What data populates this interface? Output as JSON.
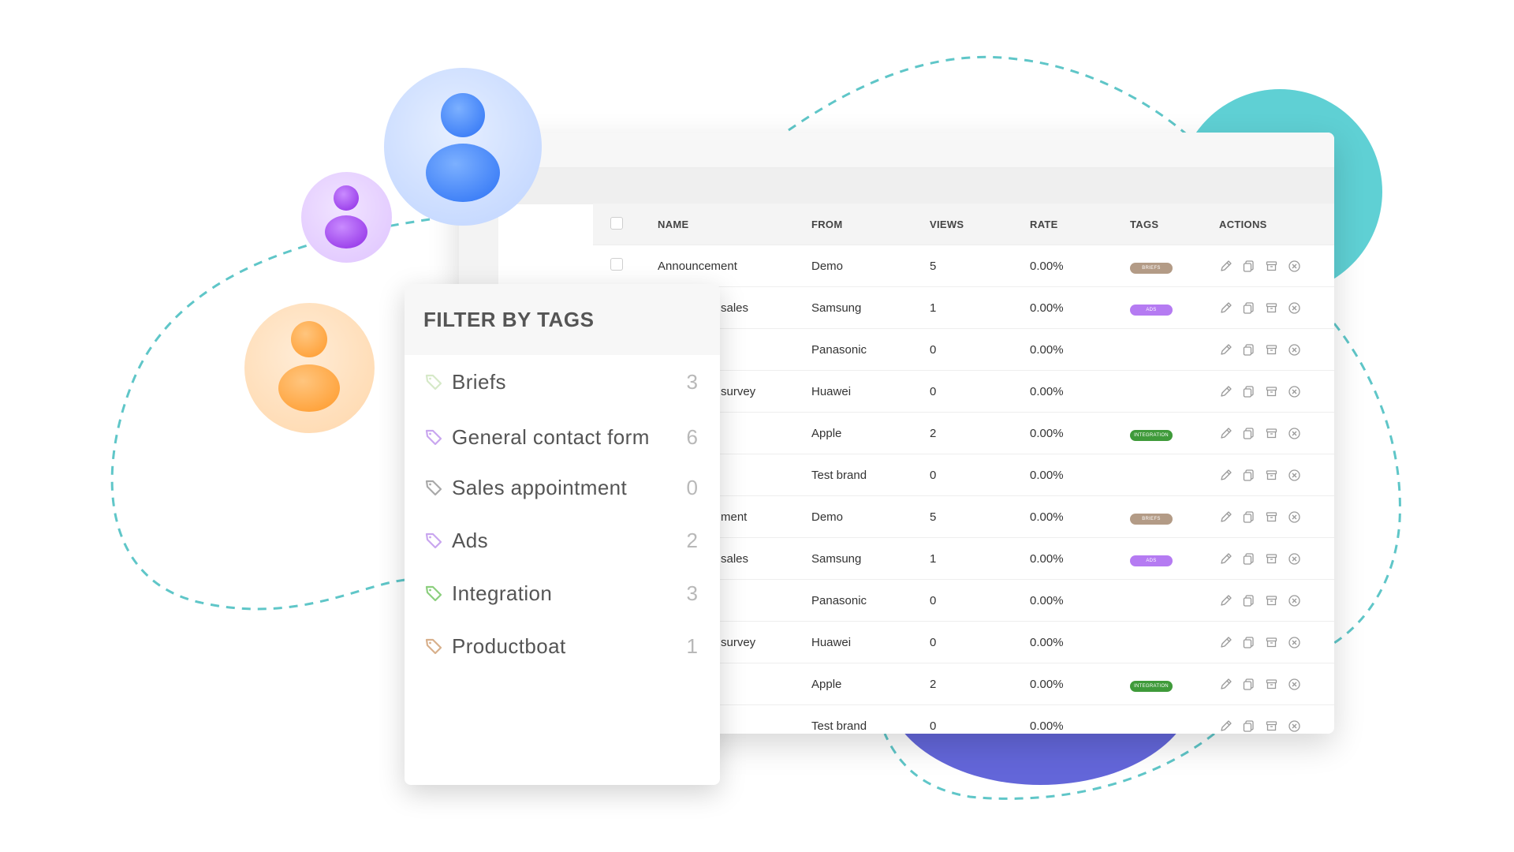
{
  "colors": {
    "teal": "#5fd0d4",
    "indigo": "#6366d9",
    "tag_briefs": "#b39b86",
    "tag_ads": "#b57bf2",
    "tag_integration": "#3f9a3a"
  },
  "table": {
    "columns": [
      "NAME",
      "FROM",
      "VIEWS",
      "RATE",
      "TAGS",
      "ACTIONS"
    ],
    "rows": [
      {
        "name": "Announcement",
        "from": "Demo",
        "views": "5",
        "rate": "0.00%",
        "tag": "BRIEFS",
        "tag_color": "#b39b86"
      },
      {
        "name": "sales",
        "from": "Samsung",
        "views": "1",
        "rate": "0.00%",
        "tag": "ADS",
        "tag_color": "#b57bf2"
      },
      {
        "name": "",
        "from": "Panasonic",
        "views": "0",
        "rate": "0.00%",
        "tag": "",
        "tag_color": ""
      },
      {
        "name": "survey",
        "from": "Huawei",
        "views": "0",
        "rate": "0.00%",
        "tag": "",
        "tag_color": ""
      },
      {
        "name": "",
        "from": "Apple",
        "views": "2",
        "rate": "0.00%",
        "tag": "INTEGRATION",
        "tag_color": "#3f9a3a"
      },
      {
        "name": "",
        "from": "Test brand",
        "views": "0",
        "rate": "0.00%",
        "tag": "",
        "tag_color": ""
      },
      {
        "name": "ment",
        "from": "Demo",
        "views": "5",
        "rate": "0.00%",
        "tag": "BRIEFS",
        "tag_color": "#b39b86"
      },
      {
        "name": "sales",
        "from": "Samsung",
        "views": "1",
        "rate": "0.00%",
        "tag": "ADS",
        "tag_color": "#b57bf2"
      },
      {
        "name": "",
        "from": "Panasonic",
        "views": "0",
        "rate": "0.00%",
        "tag": "",
        "tag_color": ""
      },
      {
        "name": "survey",
        "from": "Huawei",
        "views": "0",
        "rate": "0.00%",
        "tag": "",
        "tag_color": ""
      },
      {
        "name": "",
        "from": "Apple",
        "views": "2",
        "rate": "0.00%",
        "tag": "INTEGRATION",
        "tag_color": "#3f9a3a"
      },
      {
        "name": "",
        "from": "Test brand",
        "views": "0",
        "rate": "0.00%",
        "tag": "",
        "tag_color": ""
      }
    ],
    "action_icons": [
      "edit-icon",
      "duplicate-icon",
      "archive-icon",
      "delete-icon"
    ]
  },
  "filter": {
    "title": "FILTER BY TAGS",
    "items": [
      {
        "label": "Briefs",
        "count": "3",
        "color": "#d6e9c8"
      },
      {
        "label": "General contact form",
        "count": "6",
        "color": "#c9a6ef"
      },
      {
        "label": "Sales appointment",
        "count": "0",
        "color": "#a9a9a9"
      },
      {
        "label": "Ads",
        "count": "2",
        "color": "#c9a6ef"
      },
      {
        "label": "Integration",
        "count": "3",
        "color": "#8ccf7e"
      },
      {
        "label": "Productboat",
        "count": "1",
        "color": "#d8b08c"
      }
    ]
  },
  "avatars": [
    {
      "name": "blue-user",
      "color": "#4a8bff"
    },
    {
      "name": "purple-user",
      "color": "#a44cf0"
    },
    {
      "name": "orange-user",
      "color": "#ffac4a"
    }
  ]
}
